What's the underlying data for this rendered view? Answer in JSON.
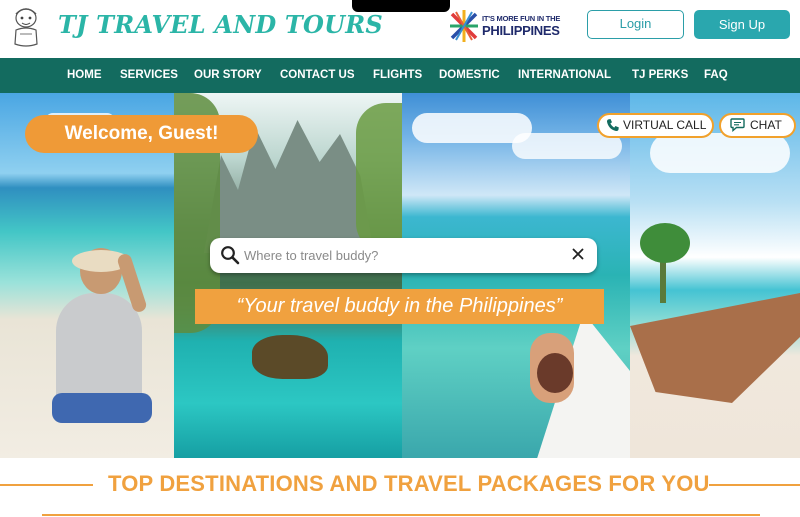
{
  "header": {
    "brand_title": "TJ TRAVEL AND TOURS",
    "tourism_logo": {
      "top_line": "IT'S MORE FUN IN THE",
      "main_line": "PHILIPPINES"
    },
    "login_label": "Login",
    "signup_label": "Sign Up"
  },
  "nav": {
    "items": [
      "HOME",
      "SERVICES",
      "OUR STORY",
      "CONTACT US",
      "FLIGHTS",
      "DOMESTIC",
      "INTERNATIONAL",
      "TJ PERKS",
      "FAQ"
    ]
  },
  "hero": {
    "welcome": "Welcome, Guest!",
    "virtual_call": "VIRTUAL CALL",
    "chat": "CHAT",
    "search_placeholder": "Where to travel buddy?",
    "tagline": "“Your travel buddy in the Philippines”"
  },
  "section": {
    "title": "TOP DESTINATIONS AND TRAVEL PACKAGES FOR YOU"
  },
  "colors": {
    "brand_teal": "#2bb5a7",
    "nav_green": "#136b5f",
    "accent_orange": "#f0a13f",
    "signup_teal": "#2aa7ae"
  },
  "icons": [
    "mascot-logo",
    "philippines-logo",
    "phone-icon",
    "chat-icon",
    "search-icon",
    "close-icon"
  ]
}
